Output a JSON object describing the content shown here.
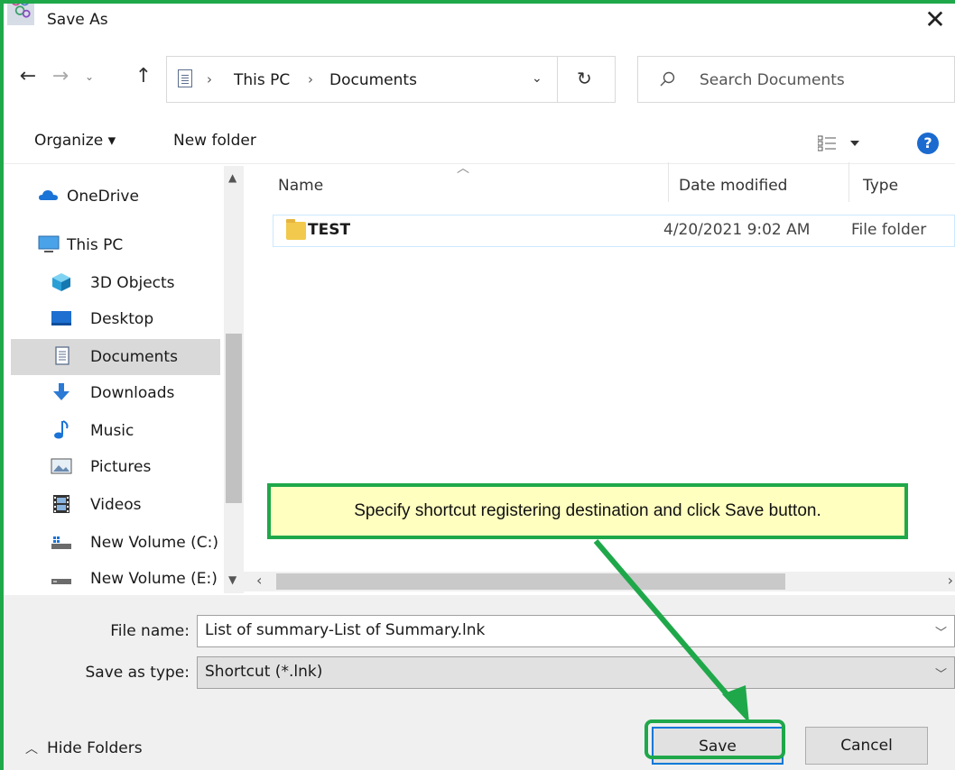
{
  "window": {
    "title": "Save As",
    "close_glyph": "✕"
  },
  "nav": {
    "back_glyph": "←",
    "forward_glyph": "→",
    "recent_glyph": "⌄",
    "up_glyph": "↑",
    "breadcrumbs": [
      "This PC",
      "Documents"
    ],
    "crumb_separator": "›",
    "dropdown_glyph": "⌄",
    "refresh_glyph": "↻"
  },
  "search": {
    "placeholder": "Search Documents"
  },
  "toolbar": {
    "organize_label": "Organize ▾",
    "new_folder_label": "New folder",
    "help_label": "?"
  },
  "sidebar": {
    "items": [
      {
        "label": "OneDrive",
        "icon": "cloud-icon"
      },
      {
        "label": "This PC",
        "icon": "monitor-icon"
      },
      {
        "label": "3D Objects",
        "icon": "cube-icon"
      },
      {
        "label": "Desktop",
        "icon": "desktop-icon"
      },
      {
        "label": "Documents",
        "icon": "document-icon",
        "selected": true
      },
      {
        "label": "Downloads",
        "icon": "download-arrow-icon"
      },
      {
        "label": "Music",
        "icon": "music-note-icon"
      },
      {
        "label": "Pictures",
        "icon": "picture-icon"
      },
      {
        "label": "Videos",
        "icon": "film-icon"
      },
      {
        "label": "New Volume (C:)",
        "icon": "windows-drive-icon"
      },
      {
        "label": "New Volume (E:)",
        "icon": "drive-icon"
      }
    ]
  },
  "filelist": {
    "columns": [
      "Name",
      "Date modified",
      "Type"
    ],
    "rows": [
      {
        "name": "TEST",
        "date": "4/20/2021 9:02 AM",
        "type": "File folder"
      }
    ]
  },
  "form": {
    "filename_label": "File name:",
    "filename_value": "List of summary-List of Summary.lnk",
    "savetype_label": "Save as type:",
    "savetype_value": "Shortcut  (*.lnk)"
  },
  "footer": {
    "hide_folders_label": "Hide Folders",
    "save_label": "Save",
    "cancel_label": "Cancel"
  },
  "callout": {
    "text": "Specify shortcut registering destination and click Save button."
  },
  "colors": {
    "highlight_green": "#1fa84a",
    "callout_bg": "#ffffc0",
    "accent_blue": "#0078d7"
  }
}
